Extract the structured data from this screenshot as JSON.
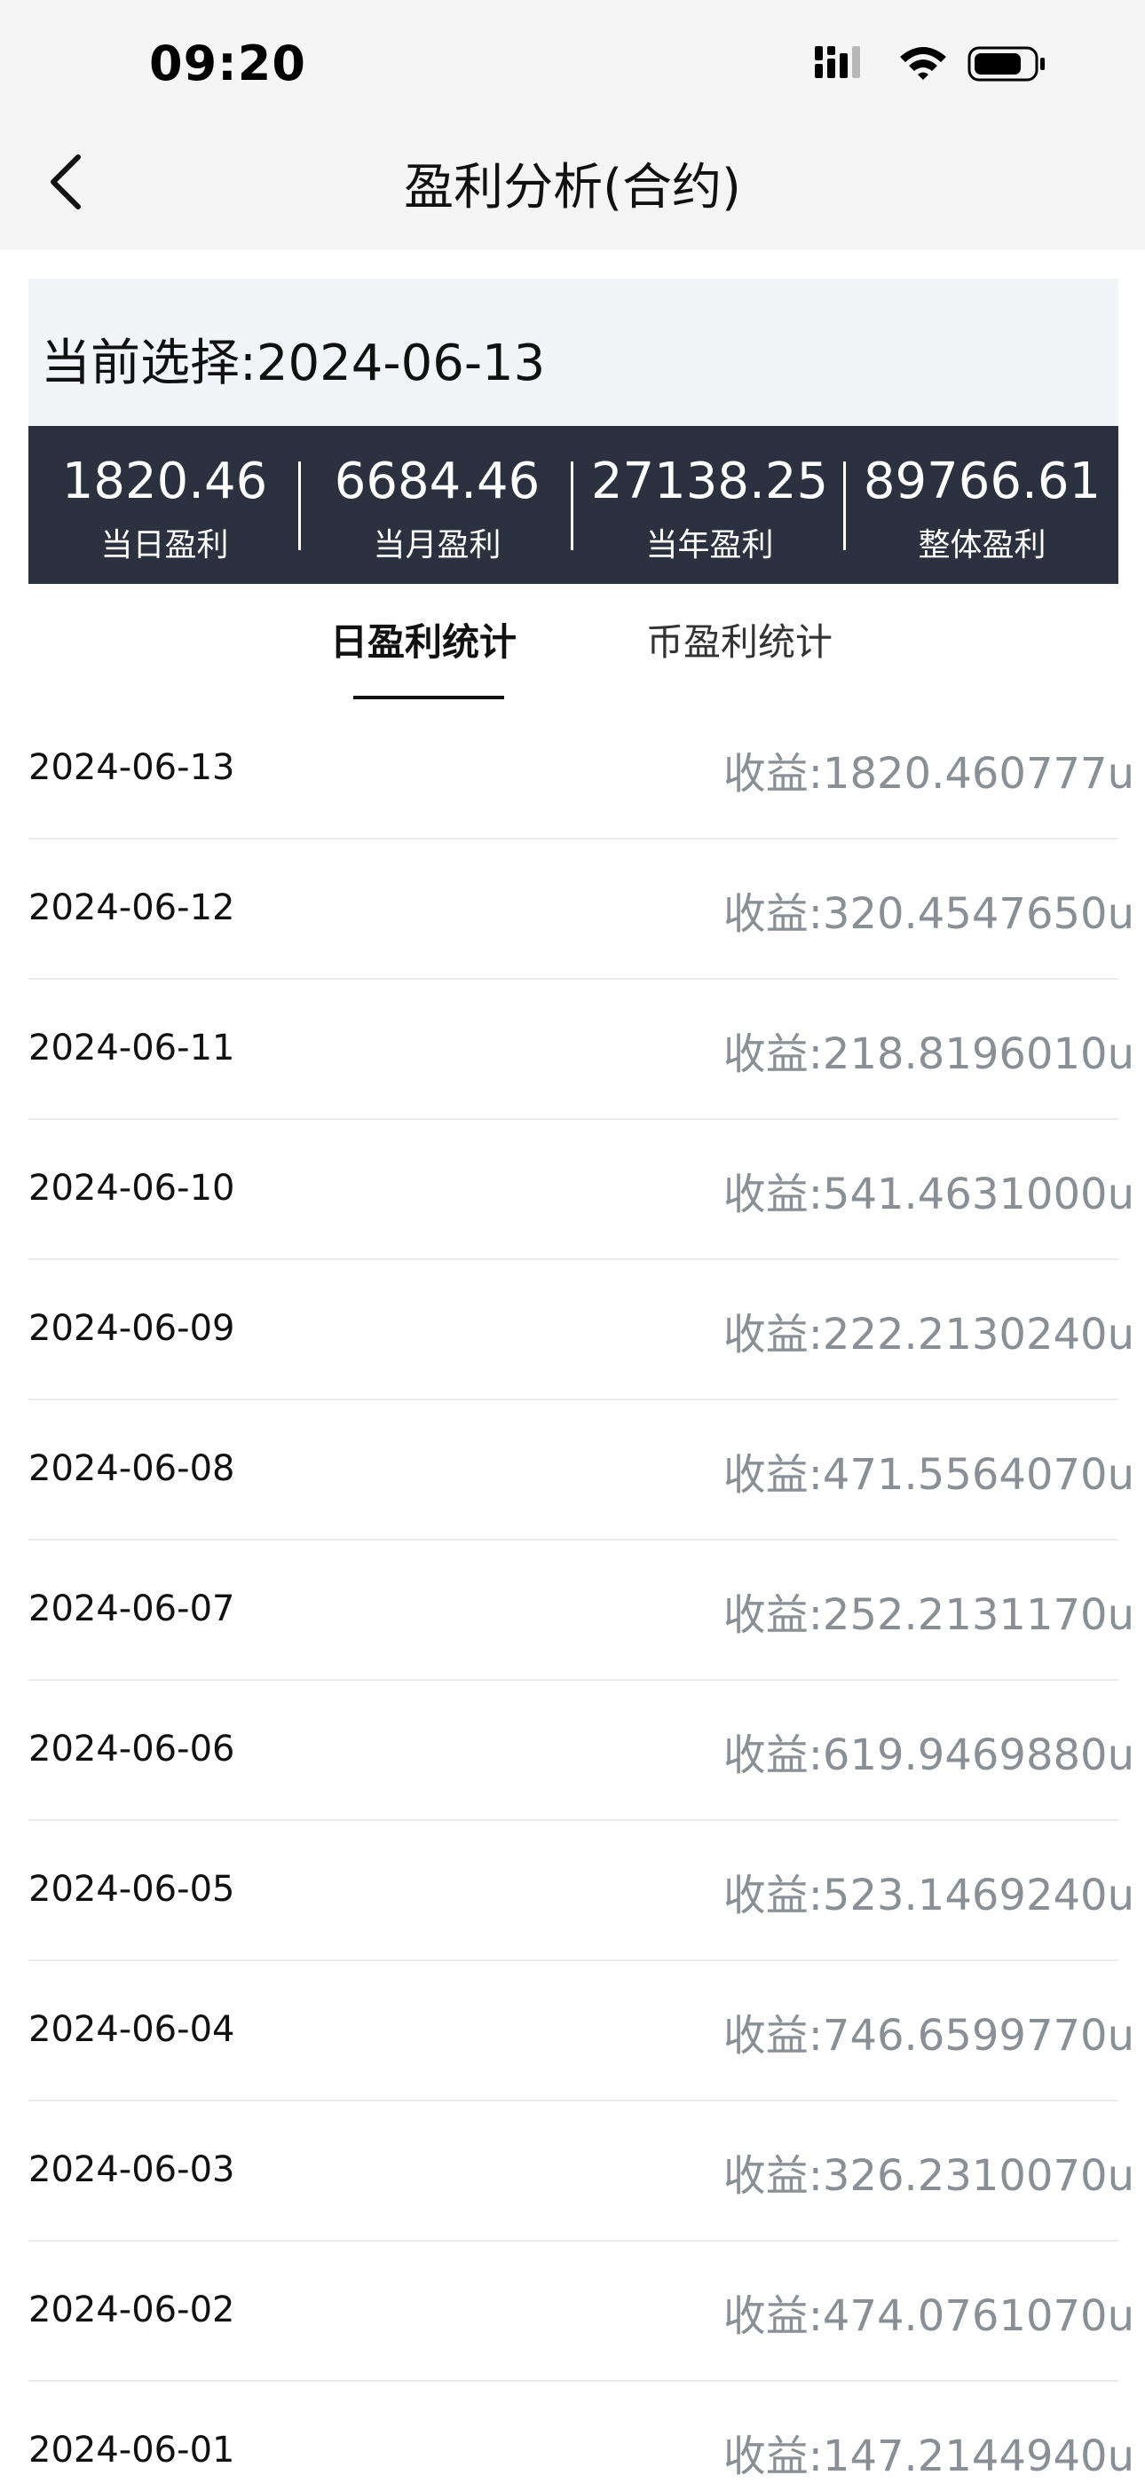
{
  "status_bar": {
    "time": "09:20"
  },
  "nav": {
    "title": "盈利分析(合约)"
  },
  "selection": {
    "text": "当前选择:2024-06-13"
  },
  "summary": [
    {
      "value": "1820.46",
      "label": "当日盈利"
    },
    {
      "value": "6684.46",
      "label": "当月盈利"
    },
    {
      "value": "27138.25",
      "label": "当年盈利"
    },
    {
      "value": "89766.61",
      "label": "整体盈利"
    }
  ],
  "tabs": [
    {
      "label": "日盈利统计",
      "active": true
    },
    {
      "label": "币盈利统计",
      "active": false
    }
  ],
  "rows": [
    {
      "date": "2024-06-13",
      "value": "收益:1820.460777u"
    },
    {
      "date": "2024-06-12",
      "value": "收益:320.4547650u"
    },
    {
      "date": "2024-06-11",
      "value": "收益:218.8196010u"
    },
    {
      "date": "2024-06-10",
      "value": "收益:541.4631000u"
    },
    {
      "date": "2024-06-09",
      "value": "收益:222.2130240u"
    },
    {
      "date": "2024-06-08",
      "value": "收益:471.5564070u"
    },
    {
      "date": "2024-06-07",
      "value": "收益:252.2131170u"
    },
    {
      "date": "2024-06-06",
      "value": "收益:619.9469880u"
    },
    {
      "date": "2024-06-05",
      "value": "收益:523.1469240u"
    },
    {
      "date": "2024-06-04",
      "value": "收益:746.6599770u"
    },
    {
      "date": "2024-06-03",
      "value": "收益:326.2310070u"
    },
    {
      "date": "2024-06-02",
      "value": "收益:474.0761070u"
    },
    {
      "date": "2024-06-01",
      "value": "收益:147.2144940u"
    }
  ],
  "icons": {
    "signal": "cellular-signal-icon",
    "wifi": "wifi-icon",
    "battery": "battery-icon",
    "back": "chevron-left-icon"
  }
}
